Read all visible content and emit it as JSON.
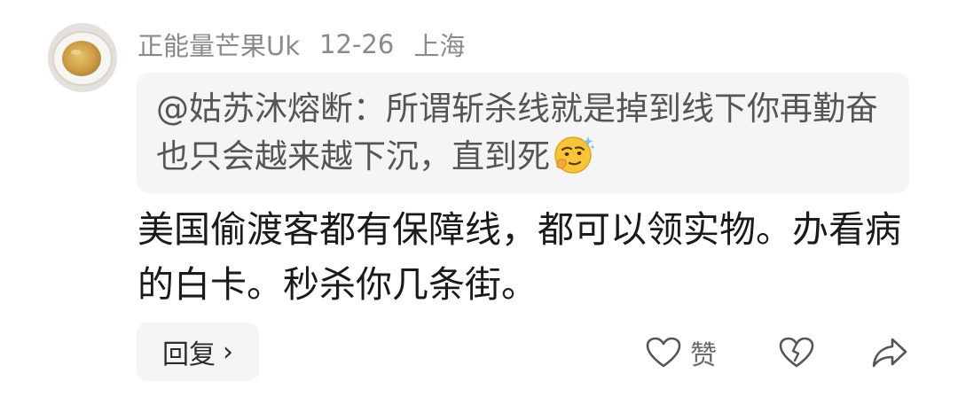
{
  "comment": {
    "username": "正能量芒果Uk",
    "date": "12-26",
    "location": "上海",
    "avatar_icon": "tea-cup-avatar",
    "quote": {
      "text": "@姑苏沐熔断：所谓斩杀线就是掉到线下你再勤奋也只会越来越下沉，直到死",
      "emoji_icon": "smirk-thinking-emoji"
    },
    "body": "美国偷渡客都有保障线，都可以领实物。办看病的白卡。秒杀你几条街。"
  },
  "actions": {
    "reply_label": "回复",
    "reply_chevron": "›",
    "like_label": "赞",
    "like_icon": "heart-outline-icon",
    "dislike_icon": "broken-heart-icon",
    "share_icon": "share-arrow-icon"
  },
  "colors": {
    "meta_text": "#8a8a8a",
    "quote_bg": "#f5f5f5",
    "quote_text": "#555555",
    "body_text": "#1a1a1a",
    "icon_stroke": "#555555"
  }
}
